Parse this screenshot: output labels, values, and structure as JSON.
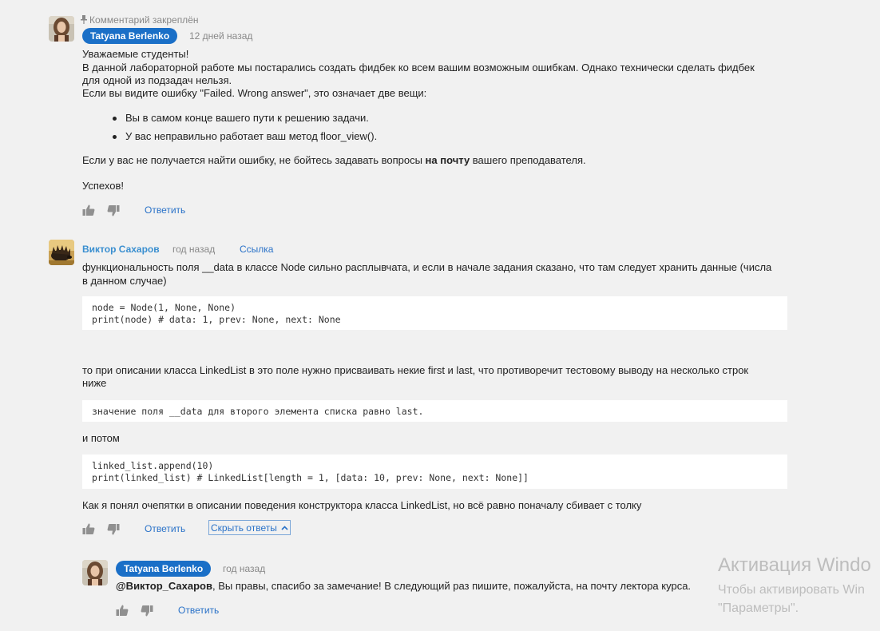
{
  "pinned_comment": {
    "pinned_label": "Комментарий закреплён",
    "author": "Tatyana Berlenko",
    "time": "12 дней назад",
    "lines": [
      "Уважаемые студенты!",
      "В данной лабораторной работе мы постарались создать фидбек ко всем вашим возможным ошибкам. Однако технически сделать фидбек",
      "для одной из подзадач нельзя.",
      "Если вы видите ошибку \"Failed. Wrong answer\", это означает две вещи:"
    ],
    "bullets": [
      "Вы в самом конце вашего пути к решению задачи.",
      "У вас неправильно работает ваш метод floor_view()."
    ],
    "para2_before": "Если у вас не получается найти ошибку, не бойтесь задавать вопросы ",
    "para2_bold": "на почту",
    "para2_after": " вашего преподавателя.",
    "closing": "Успехов!",
    "reply_label": "Ответить"
  },
  "comment2": {
    "author": "Виктор Сахаров",
    "time": "год назад",
    "link_label": "Ссылка",
    "p1_line1": "функциональность поля __data в классе Node сильно расплывчата, и если в начале задания сказано, что там следует хранить данные (числа",
    "p1_line2": "в данном случае)",
    "code1_line1": "node = Node(1, None, None)",
    "code1_line2": "print(node) # data: 1, prev: None, next: None",
    "p2_line1": "то при описании класса LinkedList в это поле нужно присваивать некие first и last, что противоречит тестовому выводу на несколько строк",
    "p2_line2": "ниже",
    "code2": "значение поля __data для второго элемента списка равно last.",
    "p3": "и потом",
    "code3_line1": "linked_list.append(10)",
    "code3_line2": "print(linked_list) # LinkedList[length = 1, [data: 10, prev: None, next: None]]",
    "p4": "Как я понял очепятки в описании поведения конструктора класса LinkedList, но всё равно поначалу сбивает с толку",
    "reply_label": "Ответить",
    "hide_replies_label": "Скрыть ответы"
  },
  "reply": {
    "author": "Tatyana Berlenko",
    "time": "год назад",
    "mention": "@Виктор_Сахаров",
    "text": ", Вы правы, спасибо за замечание! В следующий раз пишите, пожалуйста, на почту лектора курса.",
    "reply_label": "Ответить"
  },
  "watermark": {
    "line1": "Активация Windo",
    "line2": "Чтобы активировать Win",
    "line3": "\"Параметры\"."
  },
  "colors": {
    "badge": "#1a6fc7",
    "link": "#2a72c8",
    "author": "#3a8fd0",
    "background": "#f1f1f1"
  }
}
